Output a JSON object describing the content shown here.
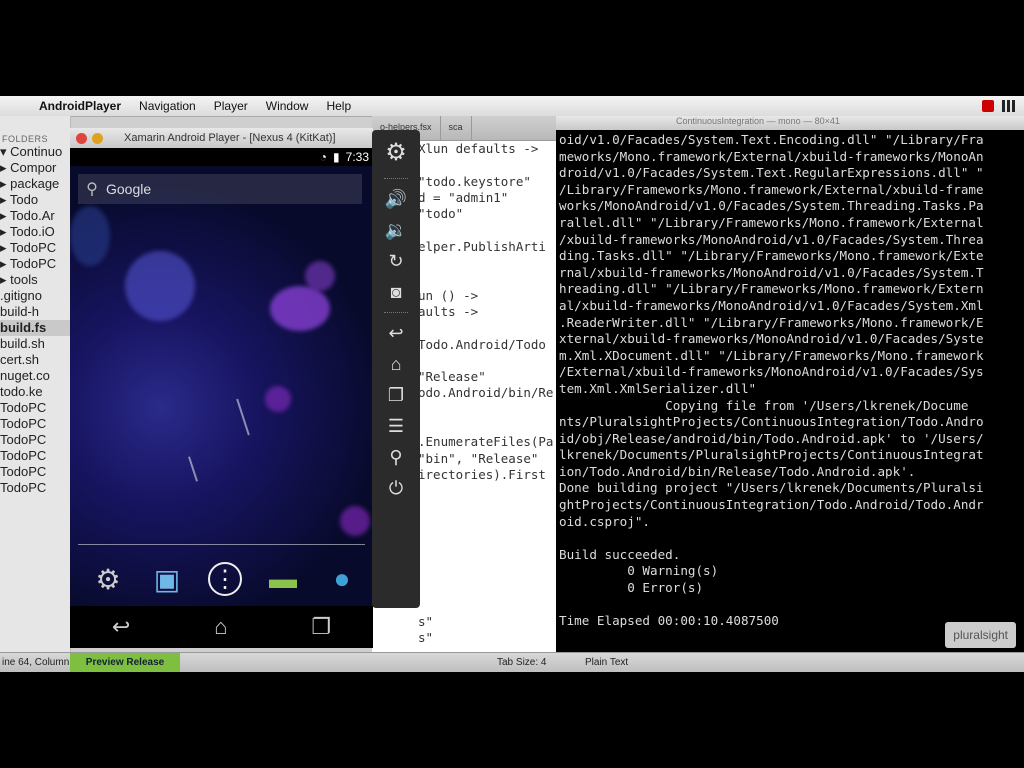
{
  "menubar": {
    "app": "AndroidPlayer",
    "menus": [
      "Navigation",
      "Player",
      "Window",
      "Help"
    ]
  },
  "sidebar": {
    "folders_label": "FOLDERS",
    "items": [
      "▾ Continuo",
      "▸ Compor",
      "▸ package",
      "▸ Todo",
      "▸ Todo.Ar",
      "▸ Todo.iO",
      "▸ TodoPC",
      "▸ TodoPC",
      "▸ tools",
      ".gitigno",
      "build-h",
      "build.fs",
      "build.sh",
      "cert.sh",
      "nuget.co",
      "todo.ke",
      "TodoPC",
      "TodoPC",
      "TodoPC",
      "TodoPC",
      "TodoPC",
      "TodoPC"
    ]
  },
  "editor": {
    "tabs": [
      "o-helpers.fsx",
      "sca"
    ],
    "lines": [
      "Xlun defaults ->",
      "",
      "\"todo.keystore\"",
      "d = \"admin1\"",
      "\"todo\"",
      "",
      "elper.PublishArti",
      "",
      "",
      "un () ->",
      "aults ->",
      "",
      "Todo.Android/Todo",
      "",
      "\"Release\"",
      "odo.Android/bin/Re",
      "",
      "",
      ".EnumerateFiles(Pa",
      "\"bin\", \"Release\"",
      "irectories).First",
      "",
      "",
      "",
      "",
      "",
      "",
      "",
      "",
      "s\"",
      "s\""
    ]
  },
  "player": {
    "title": "Xamarin Android Player - [Nexus 4 (KitKat)]",
    "time": "7:33",
    "search_placeholder": "Google"
  },
  "terminal": {
    "title": "ContinuousIntegration — mono — 80×41",
    "lines": [
      "oid/v1.0/Facades/System.Text.Encoding.dll\" \"/Library/Fra",
      "meworks/Mono.framework/External/xbuild-frameworks/MonoAn",
      "droid/v1.0/Facades/System.Text.RegularExpressions.dll\" \"",
      "/Library/Frameworks/Mono.framework/External/xbuild-frame",
      "works/MonoAndroid/v1.0/Facades/System.Threading.Tasks.Pa",
      "rallel.dll\" \"/Library/Frameworks/Mono.framework/External",
      "/xbuild-frameworks/MonoAndroid/v1.0/Facades/System.Threa",
      "ding.Tasks.dll\" \"/Library/Frameworks/Mono.framework/Exte",
      "rnal/xbuild-frameworks/MonoAndroid/v1.0/Facades/System.T",
      "hreading.dll\" \"/Library/Frameworks/Mono.framework/Extern",
      "al/xbuild-frameworks/MonoAndroid/v1.0/Facades/System.Xml",
      ".ReaderWriter.dll\" \"/Library/Frameworks/Mono.framework/E",
      "xternal/xbuild-frameworks/MonoAndroid/v1.0/Facades/Syste",
      "m.Xml.XDocument.dll\" \"/Library/Frameworks/Mono.framework",
      "/External/xbuild-frameworks/MonoAndroid/v1.0/Facades/Sys",
      "tem.Xml.XmlSerializer.dll\"",
      "              Copying file from '/Users/lkrenek/Docume",
      "nts/PluralsightProjects/ContinuousIntegration/Todo.Andro",
      "id/obj/Release/android/bin/Todo.Android.apk' to '/Users/",
      "lkrenek/Documents/PluralsightProjects/ContinuousIntegrat",
      "ion/Todo.Android/bin/Release/Todo.Android.apk'.",
      "Done building project \"/Users/lkrenek/Documents/Pluralsi",
      "ghtProjects/ContinuousIntegration/Todo.Android/Todo.Andr",
      "oid.csproj\".",
      "",
      "Build succeeded.",
      "         0 Warning(s)",
      "         0 Error(s)",
      "",
      "Time Elapsed 00:00:10.4087500"
    ],
    "watermark": "pluralsight"
  },
  "statusbar": {
    "position": "ine 64, Column",
    "preview_button": "Preview Release",
    "tab_size": "Tab Size: 4",
    "syntax": "Plain Text"
  },
  "colors": {
    "accent_green": "#7fbf3f",
    "terminal_bg": "#000000",
    "android_bg": "#171460"
  }
}
